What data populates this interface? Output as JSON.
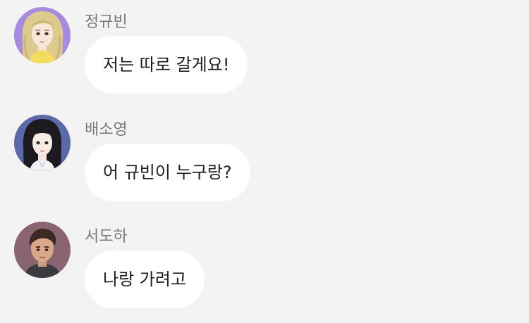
{
  "messages": [
    {
      "sender": "정규빈",
      "text": "저는 따로 갈게요!",
      "avatar_icon": "blonde-girl-avatar-icon"
    },
    {
      "sender": "배소영",
      "text": "어 규빈이 누구랑?",
      "avatar_icon": "dark-haired-girl-avatar-icon"
    },
    {
      "sender": "서도하",
      "text": "나랑 가려고",
      "avatar_icon": "dark-haired-boy-avatar-icon"
    }
  ],
  "colors": {
    "background": "#f3f3f3",
    "bubble": "#ffffff",
    "sender_name": "#7a7a7a",
    "message_text": "#1e1e1e"
  }
}
